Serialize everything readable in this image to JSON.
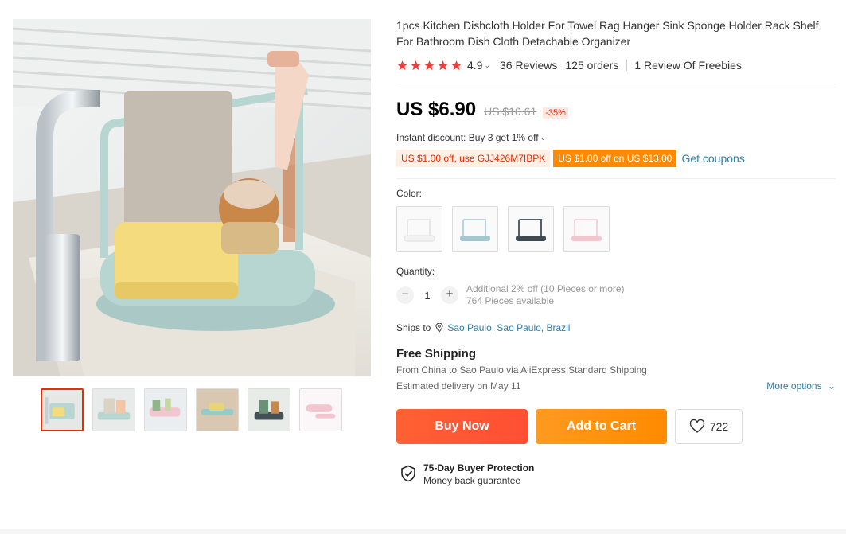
{
  "product": {
    "title": "1pcs Kitchen Dishcloth Holder For Towel Rag Hanger Sink Sponge Holder Rack Shelf For Bathroom Dish Cloth Detachable Organizer",
    "rating": "4.9",
    "reviews": "36 Reviews",
    "orders": "125 orders",
    "freebie_reviews": "1 Review Of Freebies",
    "star_count": 5,
    "star_color": "#f03b3b"
  },
  "price": {
    "current": "US $6.90",
    "original": "US $10.61",
    "discount": "-35%"
  },
  "promo": {
    "instant_discount": "Instant discount: Buy 3 get 1% off",
    "coupon_code": "US $1.00 off, use GJJ426M7IBPK",
    "coupon_threshold": "US $1.00 off on US $13.00",
    "get_coupons": "Get coupons"
  },
  "color": {
    "label": "Color:",
    "options": [
      "white",
      "light-blue",
      "dark-gray",
      "pink"
    ]
  },
  "quantity": {
    "label": "Quantity:",
    "minus": "−",
    "value": "1",
    "plus": "+",
    "note_line1": "Additional 2% off (10 Pieces or more)",
    "note_line2": "764 Pieces available"
  },
  "shipping": {
    "ships_to_label": "Ships to",
    "ships_to": "Sao Paulo, Sao Paulo, Brazil",
    "free_shipping": "Free Shipping",
    "detail": "From China to Sao Paulo via AliExpress Standard Shipping",
    "delivery": "Estimated delivery on May 11",
    "more_options": "More options"
  },
  "actions": {
    "buy_now": "Buy Now",
    "add_to_cart": "Add to Cart",
    "wishlist_count": "722"
  },
  "protection": {
    "title": "75-Day Buyer Protection",
    "subtitle": "Money back guarantee"
  },
  "colors": {
    "accent_red": "#e62e04",
    "link_blue": "#2e7da8",
    "cart_orange": "#ff8a00"
  }
}
